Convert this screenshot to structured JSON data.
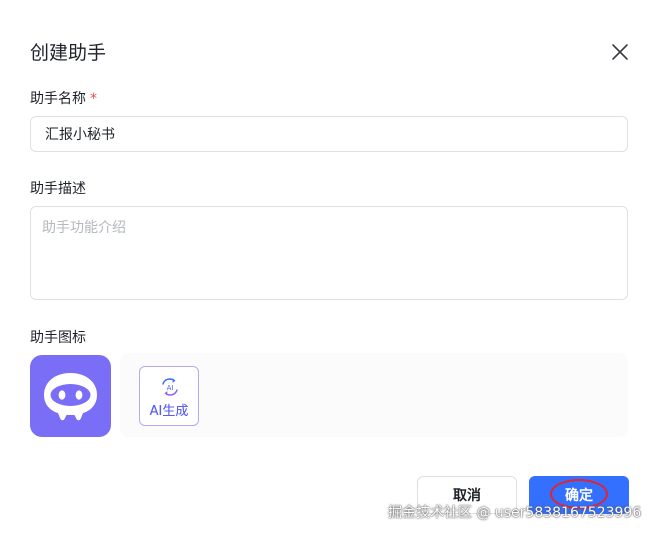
{
  "dialog": {
    "title": "创建助手",
    "close_icon": "close-icon"
  },
  "name_field": {
    "label": "助手名称",
    "required_mark": "*",
    "value": "汇报小秘书",
    "placeholder": ""
  },
  "desc_field": {
    "label": "助手描述",
    "value": "",
    "placeholder": "助手功能介绍"
  },
  "icon_field": {
    "label": "助手图标",
    "avatar_icon": "robot-face-icon",
    "ai_generate_label": "AI生成",
    "ai_mark_text": "AI"
  },
  "footer": {
    "cancel_label": "取消",
    "confirm_label": "确定"
  },
  "watermark": "掘金技术社区 @ user5838167523996",
  "colors": {
    "primary": "#3370ff",
    "avatar_bg": "#7b6ef6",
    "required": "#f54a45",
    "annotation": "#e5232b"
  }
}
